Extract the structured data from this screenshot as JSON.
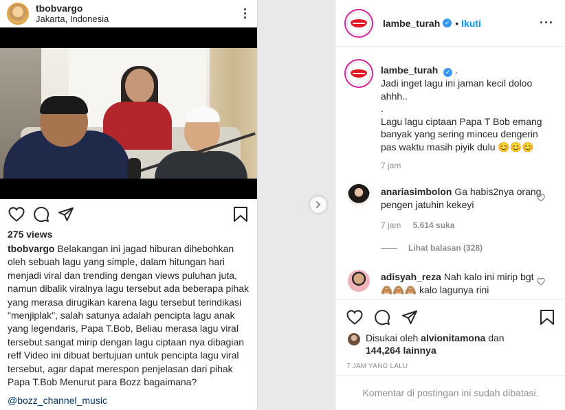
{
  "left_post": {
    "username": "tbobvargo",
    "location": "Jakarta, Indonesia",
    "views": "275 views",
    "caption_user": "tbobvargo",
    "caption_text": "Belakangan ini jagad hiburan dihebohkan oleh sebuah lagu yang simple, dalam hitungan hari menjadi viral dan trending dengan views puluhan juta, namun dibalik viralnya lagu tersebut ada beberapa pihak yang merasa dirugikan karena lagu tersebut terindikasi \"menjiplak\", salah satunya adalah pencipta lagu anak yang legendaris, Papa T.Bob, Beliau merasa lagu viral tersebut sangat mirip dengan lagu ciptaan nya dibagian reff Video ini dibuat bertujuan untuk pencipta lagu viral tersebut, agar dapat merespon penjelasan dari pihak Papa T.Bob Menurut para Bozz bagaimana?",
    "mention": "@bozz_channel_music"
  },
  "right_panel": {
    "header": {
      "username": "lambe_turah",
      "separator": "•",
      "follow_label": "Ikuti"
    },
    "post_caption": {
      "username": "lambe_turah",
      "after_badge": ".",
      "lines": [
        "Jadi inget lagu ini jaman kecil doloo",
        "ahhh..",
        ".",
        "Lagu lagu ciptaan Papa T Bob emang",
        "banyak yang sering minceu dengerin",
        "pas waktu masih piyik dulu 😊😊😊"
      ],
      "time": "7 jam"
    },
    "comments": [
      {
        "username": "anariasimbolon",
        "text": "Ga habis2nya orang pengen jatuhin kekeyi",
        "time": "7 jam",
        "likes": "5.614 suka",
        "replies": "Lihat balasan (328)"
      },
      {
        "username": "adisyah_reza",
        "text": "Nah kalo ini mirip bgt 🙈🙈🙈 kalo lagunya rini"
      }
    ],
    "liked_by": {
      "prefix": "Disukai oleh",
      "user": "alvionitamona",
      "joiner": "dan",
      "others": "144,264 lainnya"
    },
    "timestamp": "7 JAM YANG LALU",
    "comments_disabled": "Komentar di postingan ini sudah dibatasi."
  },
  "icons": [
    "heart-icon",
    "comment-icon",
    "share-icon",
    "bookmark-icon",
    "more-icon",
    "next-arrow-icon",
    "verified-badge-icon"
  ],
  "colors": {
    "link": "#00376b",
    "follow": "#0095f6",
    "muted": "#8e8e8e",
    "verified": "#3897f0"
  }
}
